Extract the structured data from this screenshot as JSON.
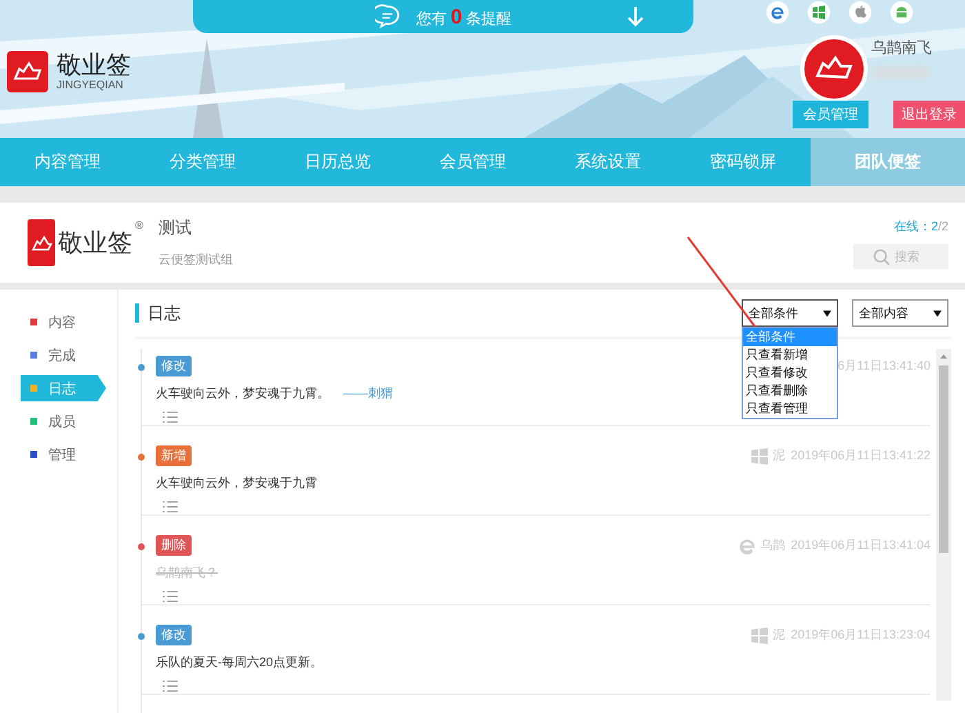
{
  "notice": {
    "prefix": "您有",
    "count": "0",
    "suffix": "条提醒"
  },
  "brand": {
    "name": "敬业签",
    "pinyin": "JINGYEQIAN"
  },
  "user": {
    "name": "乌鹊南飞"
  },
  "buttons": [
    {
      "label": "会员管理",
      "kind": "primary"
    },
    {
      "label": "退出登录",
      "kind": "danger"
    }
  ],
  "nav": [
    {
      "label": "内容管理",
      "selected": false
    },
    {
      "label": "分类管理",
      "selected": false
    },
    {
      "label": "日历总览",
      "selected": false
    },
    {
      "label": "会员管理",
      "selected": false
    },
    {
      "label": "系统设置",
      "selected": false
    },
    {
      "label": "密码锁屏",
      "selected": false
    },
    {
      "label": "团队便签",
      "selected": true
    }
  ],
  "team": {
    "logo_text": "敬业签",
    "registered": "®",
    "name": "测试",
    "subtitle": "云便签测试组",
    "online_label": "在线：",
    "online_count": "2",
    "online_total": "/2",
    "search_placeholder": "搜索"
  },
  "sidebar": [
    {
      "label": "内容",
      "color": "#e0393e",
      "selected": false
    },
    {
      "label": "完成",
      "color": "#5b7fe0",
      "selected": false
    },
    {
      "label": "日志",
      "color": "#f0b020",
      "selected": true
    },
    {
      "label": "成员",
      "color": "#20c07a",
      "selected": false
    },
    {
      "label": "管理",
      "color": "#2b4fc8",
      "selected": false
    }
  ],
  "log": {
    "title": "日志",
    "filters": [
      {
        "value": "全部条件",
        "expanded": true,
        "options": [
          {
            "label": "全部条件",
            "selected": true
          },
          {
            "label": "只查看新增",
            "selected": false
          },
          {
            "label": "只查看修改",
            "selected": false
          },
          {
            "label": "只查看删除",
            "selected": false
          },
          {
            "label": "只查看管理",
            "selected": false
          }
        ]
      },
      {
        "value": "全部内容",
        "expanded": false
      }
    ],
    "entries": [
      {
        "kind": "edit",
        "tag": "修改",
        "text": "火车驶向云外，梦安魂于九霄。",
        "link": "——刺猬",
        "struck": false,
        "time": "6月11日13:41:40"
      },
      {
        "kind": "add",
        "tag": "新增",
        "text": "火车驶向云外，梦安魂于九霄",
        "struck": false,
        "device": {
          "kind": "windows"
        },
        "user": "泥",
        "time": "2019年06月11日13:41:22"
      },
      {
        "kind": "delete",
        "tag": "删除",
        "text": "乌鹊南飞？",
        "struck": true,
        "device": {
          "kind": "ie"
        },
        "user": "乌鹊",
        "time": "2019年06月11日13:41:04"
      },
      {
        "kind": "edit",
        "tag": "修改",
        "text": "乐队的夏天-每周六20点更新。",
        "struck": false,
        "device": {
          "kind": "windows"
        },
        "user": "泥",
        "time": "2019年06月11日13:23:04"
      }
    ]
  }
}
